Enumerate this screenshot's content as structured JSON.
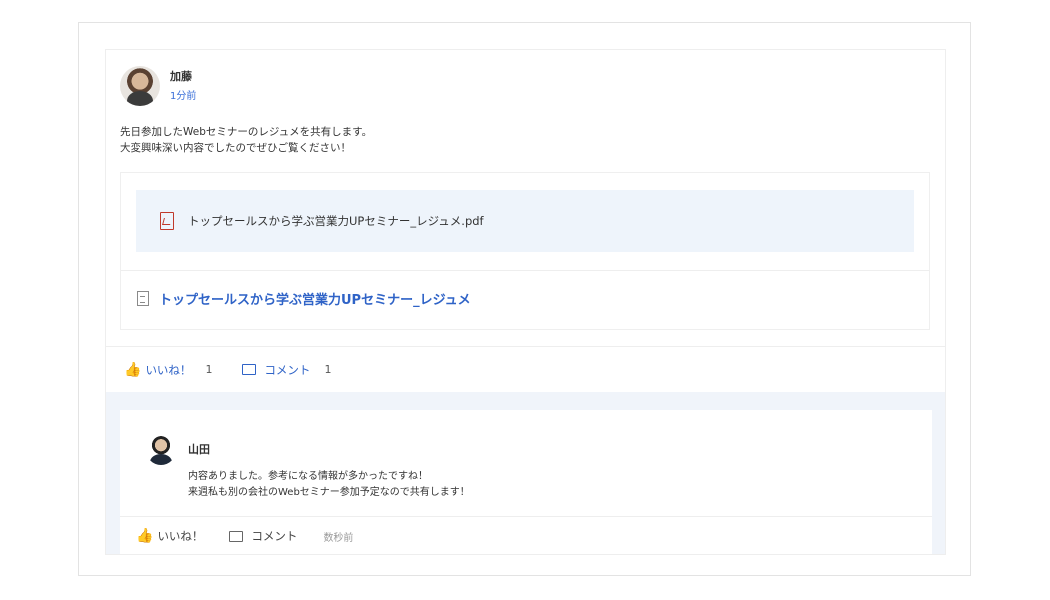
{
  "post": {
    "author_name": "加藤",
    "author_time": "1分前",
    "body_lines": [
      "先日参加したWebセミナーのレジュメを共有します。",
      "大変興味深い内容でしたのでぜひご覧ください！"
    ],
    "attachment_file": "トップセールスから学ぶ営業力UPセミナー_レジュメ.pdf",
    "linked_doc": "トップセールスから学ぶ営業力UPセミナー_レジュメ",
    "like_label": "いいね！",
    "like_count": "1",
    "comment_label": "コメント",
    "comment_count": "1"
  },
  "comment": {
    "author_name": "山田",
    "text_lines": [
      "内容ありました。参考になる情報が多かったですね！",
      "来週私も別の会社のWebセミナー参加予定なので共有します！"
    ],
    "like_label": "いいね！",
    "comment_label": "コメント",
    "time": "数秒前"
  },
  "icons": {
    "like": "thumbs-up-icon",
    "comment": "comment-icon",
    "pdf": "pdf-file-icon",
    "document": "document-icon"
  },
  "colors": {
    "accent": "#2f63c7",
    "file_row_bg": "#eef4fb",
    "comment_area_bg": "#f0f4fa",
    "pdf_red": "#c0392b"
  }
}
